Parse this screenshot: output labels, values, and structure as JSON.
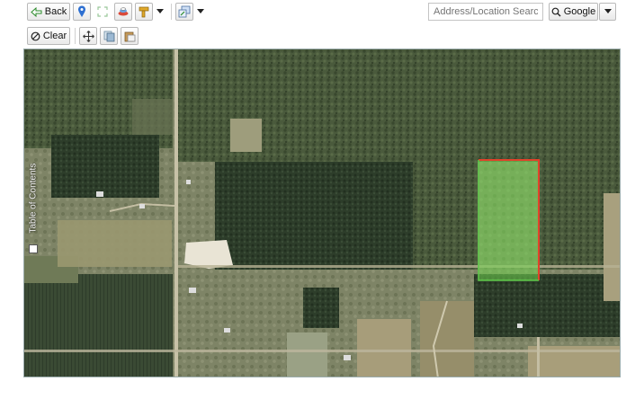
{
  "toolbar": {
    "back_label": "Back",
    "clear_label": "Clear",
    "search_placeholder": "Address/Location Search",
    "provider_label": "Google"
  },
  "sidebar": {
    "toc_label": "Table of Contents"
  },
  "colors": {
    "parcel_outline": "#e2422a",
    "parcel_fill": "#6fd34f",
    "accent_blue": "#2d6fd1"
  },
  "icons": {
    "back": "left-arrow-icon",
    "location": "location-pin-icon",
    "extent": "full-extent-icon",
    "layers": "layers-icon",
    "measure": "measure-icon",
    "tools": "tools-icon",
    "clear": "clear-icon",
    "pan": "pan-icon",
    "copy": "copy-icon",
    "paste": "paste-icon",
    "search": "search-icon",
    "dropdown": "chevron-down-icon"
  }
}
